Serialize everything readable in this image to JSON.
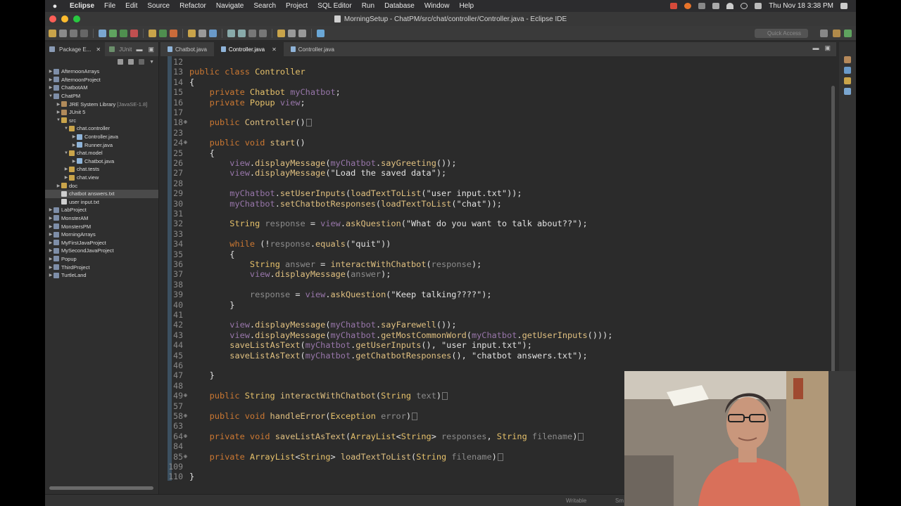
{
  "menubar": {
    "app": "Eclipse",
    "items": [
      "File",
      "Edit",
      "Source",
      "Refactor",
      "Navigate",
      "Search",
      "Project",
      "SQL Editor",
      "Run",
      "Database",
      "Window",
      "Help"
    ],
    "clock": "Thu Nov 18  3:38 PM"
  },
  "window": {
    "title": "MorningSetup - ChatPM/src/chat/controller/Controller.java - Eclipse IDE",
    "quick_access": "Quick Access"
  },
  "explorer": {
    "tab_package": "Package E...",
    "tab_junit": "JUnit",
    "tree": [
      {
        "label": "AfternoonArrays",
        "depth": 0,
        "twisty": "▶",
        "icon": "project"
      },
      {
        "label": "AfternoonProject",
        "depth": 0,
        "twisty": "▶",
        "icon": "project"
      },
      {
        "label": "ChatbotAM",
        "depth": 0,
        "twisty": "▶",
        "icon": "project"
      },
      {
        "label": "ChatPM",
        "depth": 0,
        "twisty": "▼",
        "icon": "project"
      },
      {
        "label": "JRE System Library",
        "suffix": "[JavaSE-1.8]",
        "depth": 1,
        "twisty": "▶",
        "icon": "library"
      },
      {
        "label": "JUnit 5",
        "depth": 1,
        "twisty": "▶",
        "icon": "library"
      },
      {
        "label": "src",
        "depth": 1,
        "twisty": "▼",
        "icon": "folder"
      },
      {
        "label": "chat.controller",
        "depth": 2,
        "twisty": "▼",
        "icon": "package"
      },
      {
        "label": "Controller.java",
        "depth": 3,
        "twisty": "▶",
        "icon": "java"
      },
      {
        "label": "Runner.java",
        "depth": 3,
        "twisty": "▶",
        "icon": "java"
      },
      {
        "label": "chat.model",
        "depth": 2,
        "twisty": "▼",
        "icon": "package"
      },
      {
        "label": "Chatbot.java",
        "depth": 3,
        "twisty": "▶",
        "icon": "java"
      },
      {
        "label": "chat.tests",
        "depth": 2,
        "twisty": "▶",
        "icon": "package"
      },
      {
        "label": "chat.view",
        "depth": 2,
        "twisty": "▶",
        "icon": "package"
      },
      {
        "label": "doc",
        "depth": 1,
        "twisty": "▶",
        "icon": "folder"
      },
      {
        "label": "chatbot answers.txt",
        "depth": 1,
        "twisty": "",
        "icon": "file",
        "selected": true
      },
      {
        "label": "user input.txt",
        "depth": 1,
        "twisty": "",
        "icon": "file"
      },
      {
        "label": "LabProject",
        "depth": 0,
        "twisty": "▶",
        "icon": "project"
      },
      {
        "label": "MonsterAM",
        "depth": 0,
        "twisty": "▶",
        "icon": "project"
      },
      {
        "label": "MonstersPM",
        "depth": 0,
        "twisty": "▶",
        "icon": "project"
      },
      {
        "label": "MorningArrays",
        "depth": 0,
        "twisty": "▶",
        "icon": "project"
      },
      {
        "label": "MyFirstJavaProject",
        "depth": 0,
        "twisty": "▶",
        "icon": "project"
      },
      {
        "label": "MySecondJavaProject",
        "depth": 0,
        "twisty": "▶",
        "icon": "project"
      },
      {
        "label": "Popup",
        "depth": 0,
        "twisty": "▶",
        "icon": "project"
      },
      {
        "label": "ThirdProject",
        "depth": 0,
        "twisty": "▶",
        "icon": "project"
      },
      {
        "label": "TurtleLand",
        "depth": 0,
        "twisty": "▶",
        "icon": "project"
      }
    ]
  },
  "editor": {
    "tabs": [
      {
        "label": "Chatbot.java",
        "active": false
      },
      {
        "label": "Controller.java",
        "active": true
      },
      {
        "label": "Controller.java",
        "active": false
      }
    ],
    "lines": [
      {
        "n": "12",
        "fold": false,
        "tokens": []
      },
      {
        "n": "13",
        "fold": false,
        "tokens": [
          [
            "kw",
            "public class "
          ],
          [
            "ty2",
            "Controller"
          ]
        ]
      },
      {
        "n": "14",
        "fold": false,
        "tokens": [
          [
            "st",
            "{"
          ]
        ]
      },
      {
        "n": "15",
        "fold": false,
        "tokens": [
          [
            "st",
            "    "
          ],
          [
            "kw",
            "private "
          ],
          [
            "ty2",
            "Chatbot "
          ],
          [
            "fd",
            "myChatbot"
          ],
          [
            "st",
            ";"
          ]
        ]
      },
      {
        "n": "16",
        "fold": false,
        "tokens": [
          [
            "st",
            "    "
          ],
          [
            "kw",
            "private "
          ],
          [
            "ty2",
            "Popup "
          ],
          [
            "fd",
            "view"
          ],
          [
            "st",
            ";"
          ]
        ]
      },
      {
        "n": "17",
        "fold": false,
        "tokens": []
      },
      {
        "n": "18",
        "fold": true,
        "tokens": [
          [
            "st",
            "    "
          ],
          [
            "kw",
            "public "
          ],
          [
            "mt",
            "Controller"
          ],
          [
            "st",
            "()"
          ],
          [
            "box",
            ""
          ]
        ]
      },
      {
        "n": "23",
        "fold": false,
        "tokens": []
      },
      {
        "n": "24",
        "fold": true,
        "tokens": [
          [
            "st",
            "    "
          ],
          [
            "kw",
            "public void "
          ],
          [
            "mt",
            "start"
          ],
          [
            "st",
            "()"
          ]
        ]
      },
      {
        "n": "25",
        "fold": false,
        "tokens": [
          [
            "st",
            "    {"
          ]
        ]
      },
      {
        "n": "26",
        "fold": false,
        "tokens": [
          [
            "st",
            "        "
          ],
          [
            "fd",
            "view"
          ],
          [
            "st",
            "."
          ],
          [
            "mt",
            "displayMessage"
          ],
          [
            "st",
            "("
          ],
          [
            "fd",
            "myChatbot"
          ],
          [
            "st",
            "."
          ],
          [
            "mt",
            "sayGreeting"
          ],
          [
            "st",
            "());"
          ]
        ]
      },
      {
        "n": "27",
        "fold": false,
        "tokens": [
          [
            "st",
            "        "
          ],
          [
            "fd",
            "view"
          ],
          [
            "st",
            "."
          ],
          [
            "mt",
            "displayMessage"
          ],
          [
            "st",
            "(\"Load the saved data\");"
          ]
        ]
      },
      {
        "n": "28",
        "fold": false,
        "tokens": []
      },
      {
        "n": "29",
        "fold": false,
        "tokens": [
          [
            "st",
            "        "
          ],
          [
            "fd",
            "myChatbot"
          ],
          [
            "st",
            "."
          ],
          [
            "mt",
            "setUserInputs"
          ],
          [
            "st",
            "("
          ],
          [
            "mt",
            "loadTextToList"
          ],
          [
            "st",
            "(\"user input.txt\"));"
          ]
        ]
      },
      {
        "n": "30",
        "fold": false,
        "tokens": [
          [
            "st",
            "        "
          ],
          [
            "fd",
            "myChatbot"
          ],
          [
            "st",
            "."
          ],
          [
            "mt",
            "setChatbotResponses"
          ],
          [
            "st",
            "("
          ],
          [
            "mt",
            "loadTextToList"
          ],
          [
            "st",
            "(\"chat\"));"
          ]
        ]
      },
      {
        "n": "31",
        "fold": false,
        "tokens": []
      },
      {
        "n": "32",
        "fold": false,
        "tokens": [
          [
            "st",
            "        "
          ],
          [
            "ty2",
            "String "
          ],
          [
            "par",
            "response"
          ],
          [
            "st",
            " = "
          ],
          [
            "fd",
            "view"
          ],
          [
            "st",
            "."
          ],
          [
            "mt",
            "askQuestion"
          ],
          [
            "st",
            "(\"What do you want to talk about??\");"
          ]
        ]
      },
      {
        "n": "33",
        "fold": false,
        "tokens": []
      },
      {
        "n": "34",
        "fold": false,
        "tokens": [
          [
            "st",
            "        "
          ],
          [
            "kw",
            "while "
          ],
          [
            "st",
            "(!"
          ],
          [
            "par",
            "response"
          ],
          [
            "st",
            "."
          ],
          [
            "mt",
            "equals"
          ],
          [
            "st",
            "(\"quit\"))"
          ]
        ]
      },
      {
        "n": "35",
        "fold": false,
        "tokens": [
          [
            "st",
            "        {"
          ]
        ]
      },
      {
        "n": "36",
        "fold": false,
        "tokens": [
          [
            "st",
            "            "
          ],
          [
            "ty2",
            "String "
          ],
          [
            "par",
            "answer"
          ],
          [
            "st",
            " = "
          ],
          [
            "mt",
            "interactWithChatbot"
          ],
          [
            "st",
            "("
          ],
          [
            "par",
            "response"
          ],
          [
            "st",
            ");"
          ]
        ]
      },
      {
        "n": "37",
        "fold": false,
        "tokens": [
          [
            "st",
            "            "
          ],
          [
            "fd",
            "view"
          ],
          [
            "st",
            "."
          ],
          [
            "mt",
            "displayMessage"
          ],
          [
            "st",
            "("
          ],
          [
            "par",
            "answer"
          ],
          [
            "st",
            ");"
          ]
        ]
      },
      {
        "n": "38",
        "fold": false,
        "tokens": []
      },
      {
        "n": "39",
        "fold": false,
        "tokens": [
          [
            "st",
            "            "
          ],
          [
            "par",
            "response"
          ],
          [
            "st",
            " = "
          ],
          [
            "fd",
            "view"
          ],
          [
            "st",
            "."
          ],
          [
            "mt",
            "askQuestion"
          ],
          [
            "st",
            "(\"Keep talking????\");"
          ]
        ]
      },
      {
        "n": "40",
        "fold": false,
        "tokens": [
          [
            "st",
            "        }"
          ]
        ]
      },
      {
        "n": "41",
        "fold": false,
        "tokens": []
      },
      {
        "n": "42",
        "fold": false,
        "tokens": [
          [
            "st",
            "        "
          ],
          [
            "fd",
            "view"
          ],
          [
            "st",
            "."
          ],
          [
            "mt",
            "displayMessage"
          ],
          [
            "st",
            "("
          ],
          [
            "fd",
            "myChatbot"
          ],
          [
            "st",
            "."
          ],
          [
            "mt",
            "sayFarewell"
          ],
          [
            "st",
            "());"
          ]
        ]
      },
      {
        "n": "43",
        "fold": false,
        "tokens": [
          [
            "st",
            "        "
          ],
          [
            "fd",
            "view"
          ],
          [
            "st",
            "."
          ],
          [
            "mt",
            "displayMessage"
          ],
          [
            "st",
            "("
          ],
          [
            "fd",
            "myChatbot"
          ],
          [
            "st",
            "."
          ],
          [
            "mt",
            "getMostCommonWord"
          ],
          [
            "st",
            "("
          ],
          [
            "fd",
            "myChatbot"
          ],
          [
            "st",
            "."
          ],
          [
            "mt",
            "getUserInputs"
          ],
          [
            "st",
            "()));"
          ]
        ]
      },
      {
        "n": "44",
        "fold": false,
        "tokens": [
          [
            "st",
            "        "
          ],
          [
            "mt",
            "saveListAsText"
          ],
          [
            "st",
            "("
          ],
          [
            "fd",
            "myChatbot"
          ],
          [
            "st",
            "."
          ],
          [
            "mt",
            "getUserInputs"
          ],
          [
            "st",
            "(), \"user input.txt\");"
          ]
        ]
      },
      {
        "n": "45",
        "fold": false,
        "tokens": [
          [
            "st",
            "        "
          ],
          [
            "mt",
            "saveListAsText"
          ],
          [
            "st",
            "("
          ],
          [
            "fd",
            "myChatbot"
          ],
          [
            "st",
            "."
          ],
          [
            "mt",
            "getChatbotResponses"
          ],
          [
            "st",
            "(), \"chatbot answers.txt\");"
          ]
        ]
      },
      {
        "n": "46",
        "fold": false,
        "tokens": []
      },
      {
        "n": "47",
        "fold": false,
        "tokens": [
          [
            "st",
            "    }"
          ]
        ]
      },
      {
        "n": "48",
        "fold": false,
        "tokens": []
      },
      {
        "n": "49",
        "fold": true,
        "tokens": [
          [
            "st",
            "    "
          ],
          [
            "kw",
            "public "
          ],
          [
            "ty2",
            "String "
          ],
          [
            "mt",
            "interactWithChatbot"
          ],
          [
            "st",
            "("
          ],
          [
            "ty2",
            "String "
          ],
          [
            "par",
            "text"
          ],
          [
            "st",
            ")"
          ],
          [
            "box",
            ""
          ]
        ]
      },
      {
        "n": "57",
        "fold": false,
        "tokens": []
      },
      {
        "n": "58",
        "fold": true,
        "tokens": [
          [
            "st",
            "    "
          ],
          [
            "kw",
            "public void "
          ],
          [
            "mt",
            "handleError"
          ],
          [
            "st",
            "("
          ],
          [
            "ty2",
            "Exception "
          ],
          [
            "par",
            "error"
          ],
          [
            "st",
            ")"
          ],
          [
            "box",
            ""
          ]
        ]
      },
      {
        "n": "63",
        "fold": false,
        "tokens": []
      },
      {
        "n": "64",
        "fold": true,
        "tokens": [
          [
            "st",
            "    "
          ],
          [
            "kw",
            "private void "
          ],
          [
            "mt",
            "saveListAsText"
          ],
          [
            "st",
            "("
          ],
          [
            "ty2",
            "ArrayList"
          ],
          [
            "st",
            "<"
          ],
          [
            "ty2",
            "String"
          ],
          [
            "st",
            "> "
          ],
          [
            "par",
            "responses"
          ],
          [
            "st",
            ", "
          ],
          [
            "ty2",
            "String "
          ],
          [
            "par",
            "filename"
          ],
          [
            "st",
            ")"
          ],
          [
            "box",
            ""
          ]
        ]
      },
      {
        "n": "84",
        "fold": false,
        "tokens": []
      },
      {
        "n": "85",
        "fold": true,
        "tokens": [
          [
            "st",
            "    "
          ],
          [
            "kw",
            "private "
          ],
          [
            "ty2",
            "ArrayList"
          ],
          [
            "st",
            "<"
          ],
          [
            "ty2",
            "String"
          ],
          [
            "st",
            "> "
          ],
          [
            "mt",
            "loadTextToList"
          ],
          [
            "st",
            "("
          ],
          [
            "ty2",
            "String "
          ],
          [
            "par",
            "filename"
          ],
          [
            "st",
            ")"
          ],
          [
            "box",
            ""
          ]
        ]
      },
      {
        "n": "109",
        "fold": false,
        "tokens": []
      },
      {
        "n": "110",
        "fold": false,
        "tokens": [
          [
            "st",
            "}"
          ]
        ]
      }
    ]
  },
  "status": {
    "writable": "Writable",
    "insert": "Sm"
  },
  "colors": {
    "keyword": "#cc7832",
    "field": "#9876aa",
    "type": "#e6c16a",
    "method": "#e0c080",
    "param": "#8c8c8c",
    "background": "#2b2b2b"
  }
}
